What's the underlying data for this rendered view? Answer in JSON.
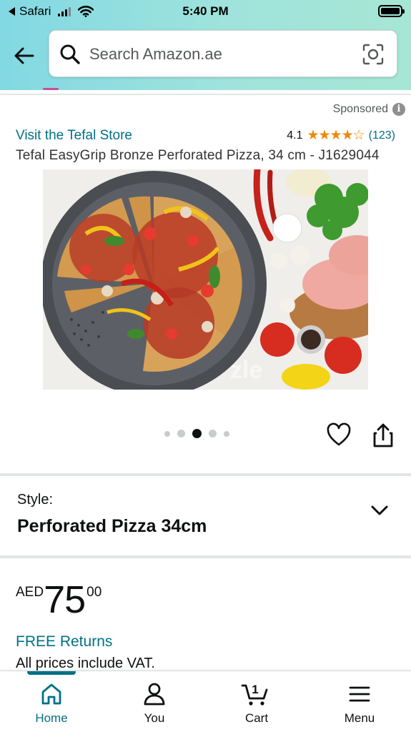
{
  "status_bar": {
    "carrier": "Safari",
    "time": "5:40 PM"
  },
  "search": {
    "placeholder": "Search Amazon.ae",
    "value": ""
  },
  "icons": {
    "back": "back-arrow-icon",
    "search": "search-icon",
    "camera": "camera-icon",
    "info": "info-icon",
    "wishlist": "heart-icon",
    "share": "share-icon",
    "style_dropdown": "chevron-down-icon",
    "nav_home": "home-icon",
    "nav_you": "person-icon",
    "nav_cart": "cart-icon",
    "nav_menu": "hamburger-menu-icon"
  },
  "product": {
    "sponsored_label": "Sponsored",
    "info_glyph": "i",
    "store_link": "Visit the Tefal Store",
    "rating_value": "4.1",
    "rating_stars": "★★★★☆",
    "rating_count": "(123)",
    "title": "Tefal EasyGrip Bronze Perforated Pizza, 34 cm - J1629044",
    "image_alt": "Perforated pizza tray with sliced pizza beside fresh vegetables and chicken",
    "image_watermark": "zle",
    "carousel": {
      "total": 5,
      "active_index": 2
    }
  },
  "style_section": {
    "label": "Style:",
    "value": "Perforated Pizza 34cm"
  },
  "pricing": {
    "currency": "AED",
    "whole": "75",
    "fraction": "00",
    "free_returns": "FREE Returns",
    "vat_note": "All prices include VAT."
  },
  "bottom_nav": {
    "cart_count": "1",
    "items": [
      {
        "label": "Home",
        "active": true
      },
      {
        "label": "You",
        "active": false
      },
      {
        "label": "Cart",
        "active": false
      },
      {
        "label": "Menu",
        "active": false
      }
    ]
  },
  "colors": {
    "link": "#007185",
    "star": "#f08804",
    "header_gradient_start": "#82d8e3",
    "header_gradient_end": "#a6e6d4",
    "text": "#0f1111"
  }
}
